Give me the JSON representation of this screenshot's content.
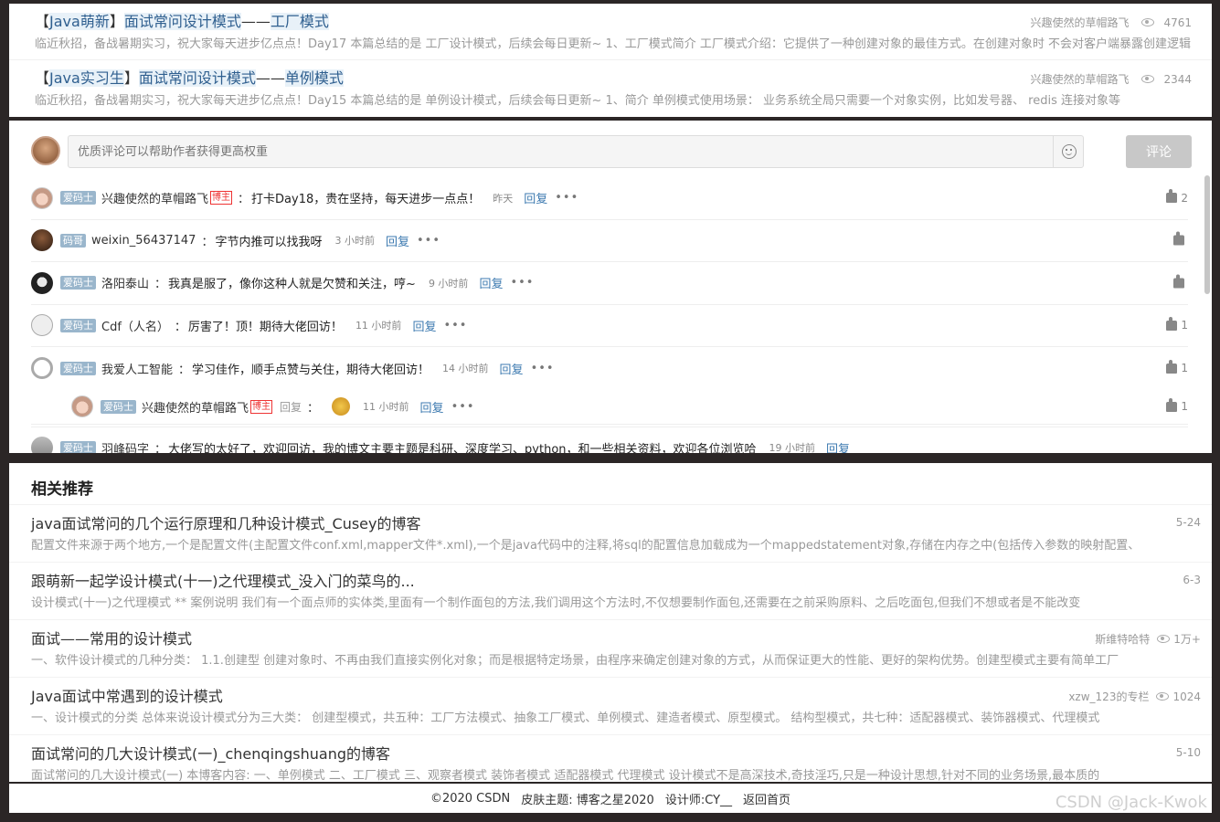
{
  "articles": [
    {
      "title_parts": [
        "【",
        "Java萌新",
        "】",
        "面试常问设计模式",
        "——",
        "工厂模式"
      ],
      "title_hl": [
        false,
        true,
        false,
        true,
        false,
        true
      ],
      "author": "兴趣使然的草帽路飞",
      "views": "4761",
      "desc": "临近秋招，备战暑期实习，祝大家每天进步亿点点！Day17 本篇总结的是 工厂设计模式，后续会每日更新~ 1、工厂模式简介 工厂模式介绍：它提供了一种创建对象的最佳方式。在创建对象时 不会对客户端暴露创建逻辑"
    },
    {
      "title_parts": [
        "【",
        "Java实习生",
        "】",
        "面试常问设计模式",
        "——",
        "单例模式"
      ],
      "title_hl": [
        false,
        true,
        false,
        true,
        false,
        true
      ],
      "author": "兴趣使然的草帽路飞",
      "views": "2344",
      "desc": "临近秋招，备战暑期实习，祝大家每天进步亿点点！Day15 本篇总结的是 单例设计模式，后续会每日更新~ 1、简介 单例模式使用场景： 业务系统全局只需要一个对象实例，比如发号器、 redis 连接对象等"
    }
  ],
  "comment_box": {
    "placeholder": "优质评论可以帮助作者获得更高权重",
    "submit": "评论"
  },
  "comments": [
    {
      "badge": "爱码士",
      "name": "兴趣使然的草帽路飞",
      "host": "博主",
      "text": "打卡Day18，贵在坚持，每天进步一点点！",
      "time": "昨天",
      "reply": "回复",
      "likes": "2"
    },
    {
      "badge": "码哥",
      "name": "weixin_56437147",
      "host": "",
      "text": "字节内推可以找我呀",
      "time": "3 小时前",
      "reply": "回复",
      "likes": ""
    },
    {
      "badge": "爱码士",
      "name": "洛阳泰山",
      "host": "",
      "text": "我真是服了，像你这种人就是欠赞和关注，哼~",
      "time": "9 小时前",
      "reply": "回复",
      "likes": ""
    },
    {
      "badge": "爱码士",
      "name": "Cdf（人名）",
      "host": "",
      "text": "厉害了！顶！期待大佬回访！",
      "time": "11 小时前",
      "reply": "回复",
      "likes": "1"
    },
    {
      "badge": "爱码士",
      "name": "我爱人工智能",
      "host": "",
      "text": "学习佳作，顺手点赞与关住，期待大佬回访！",
      "time": "14 小时前",
      "reply": "回复",
      "likes": "1"
    }
  ],
  "sub_reply": {
    "badge": "爱码士",
    "name": "兴趣使然的草帽路飞",
    "host": "博主",
    "reply_word": "回复",
    "time": "11 小时前",
    "reply": "回复",
    "likes": "1"
  },
  "partial_comment": {
    "badge": "爱码士",
    "name": "羽峰码字",
    "text": "大佬写的太好了，欢迎回访，我的博文主要主题是科研、深度学习、python，和一些相关资料，欢迎各位浏览哈",
    "time": "19 小时前",
    "reply": "回复"
  },
  "recommend": {
    "heading": "相关推荐",
    "items": [
      {
        "title": "java面试常问的几个运行原理和几种设计模式_Cusey的博客",
        "meta": "5-24",
        "views": "",
        "desc": "配置文件来源于两个地方,一个是配置文件(主配置文件conf.xml,mapper文件*.xml),一个是java代码中的注释,将sql的配置信息加载成为一个mappedstatement对象,存储在内存之中(包括传入参数的映射配置、"
      },
      {
        "title": "跟萌新一起学设计模式(十一)之代理模式_没入门的菜鸟的...",
        "meta": "6-3",
        "views": "",
        "desc": "设计模式(十一)之代理模式 ** 案例说明         我们有一个面点师的实体类,里面有一个制作面包的方法,我们调用这个方法时,不仅想要制作面包,还需要在之前采购原料、之后吃面包,但我们不想或者是不能改变"
      },
      {
        "title": "面试——常用的设计模式",
        "meta": "斯维特哈特",
        "views": "1万+",
        "desc": "一、软件设计模式的几种分类： 1.1.创建型 创建对象时、不再由我们直接实例化对象；而是根据特定场景，由程序来确定创建对象的方式，从而保证更大的性能、更好的架构优势。创建型模式主要有简单工厂"
      },
      {
        "title": "Java面试中常遇到的设计模式",
        "meta": "xzw_123的专栏",
        "views": "1024",
        "desc": "一、设计模式的分类 总体来说设计模式分为三大类： 创建型模式，共五种：工厂方法模式、抽象工厂模式、单例模式、建造者模式、原型模式。 结构型模式，共七种：适配器模式、装饰器模式、代理模式"
      },
      {
        "title": "面试常问的几大设计模式(一)_chenqingshuang的博客",
        "meta": "5-10",
        "views": "",
        "desc": "面试常问的几大设计模式(一) 本博客内容: 一、单例模式 二、工厂模式 三、观察者模式 装饰者模式 适配器模式 代理模式 设计模式不是高深技术,奇技淫巧,只是一种设计思想,针对不同的业务场景,最本质的"
      }
    ]
  },
  "footer": {
    "copyright": "©2020 CSDN",
    "theme": "皮肤主题: 博客之星2020",
    "designer": "设计师:CY__",
    "home": "返回首页"
  },
  "watermark": "CSDN @Jack-Kwok"
}
